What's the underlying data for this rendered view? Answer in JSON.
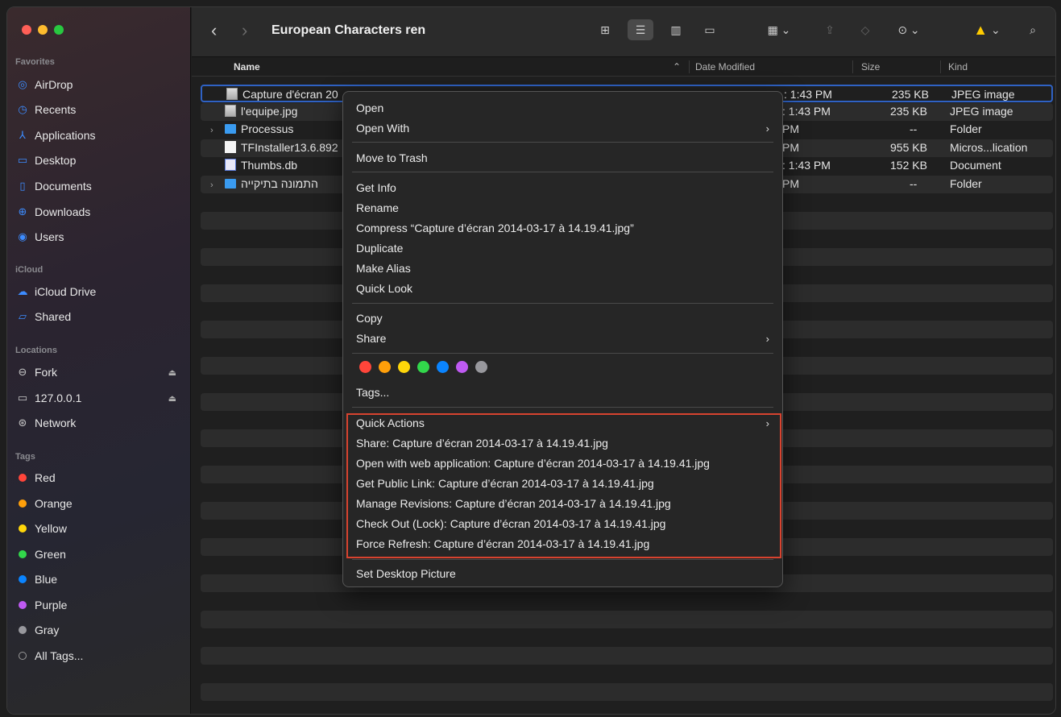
{
  "window": {
    "folder_title": "European Characters ren"
  },
  "sidebar": {
    "sections": {
      "favorites": "Favorites",
      "icloud": "iCloud",
      "locations": "Locations",
      "tags": "Tags"
    },
    "favorites": [
      {
        "label": "AirDrop",
        "icon": "airdrop-icon"
      },
      {
        "label": "Recents",
        "icon": "clock-icon"
      },
      {
        "label": "Applications",
        "icon": "applications-icon"
      },
      {
        "label": "Desktop",
        "icon": "desktop-icon"
      },
      {
        "label": "Documents",
        "icon": "document-icon"
      },
      {
        "label": "Downloads",
        "icon": "download-icon"
      },
      {
        "label": "Users",
        "icon": "user-icon"
      }
    ],
    "icloud": [
      {
        "label": "iCloud Drive",
        "icon": "cloud-icon"
      },
      {
        "label": "Shared",
        "icon": "shared-folder-icon"
      }
    ],
    "locations": [
      {
        "label": "Fork",
        "icon": "drive-icon"
      },
      {
        "label": "127.0.0.1",
        "icon": "monitor-icon"
      },
      {
        "label": "Network",
        "icon": "globe-icon"
      }
    ],
    "tags": [
      {
        "label": "Red",
        "color": "#ff453a"
      },
      {
        "label": "Orange",
        "color": "#ff9f0a"
      },
      {
        "label": "Yellow",
        "color": "#ffd60a"
      },
      {
        "label": "Green",
        "color": "#32d74b"
      },
      {
        "label": "Blue",
        "color": "#0a84ff"
      },
      {
        "label": "Purple",
        "color": "#bf5af2"
      },
      {
        "label": "Gray",
        "color": "#98989d"
      },
      {
        "label": "All Tags...",
        "color": ""
      }
    ]
  },
  "columns": {
    "name": "Name",
    "date_modified": "Date Modified",
    "size": "Size",
    "kind": "Kind"
  },
  "files": [
    {
      "name": "Capture d'écran 20",
      "date": ": 1:43 PM",
      "size": "235 KB",
      "kind": "JPEG image",
      "icon": "image-file-icon"
    },
    {
      "name": "l'equipe.jpg",
      "date": ": 1:43 PM",
      "size": "235 KB",
      "kind": "JPEG image",
      "icon": "image-file-icon"
    },
    {
      "name": "Processus",
      "date": "PM",
      "size": "--",
      "kind": "Folder",
      "icon": "folder-icon"
    },
    {
      "name": "TFInstaller13.6.892",
      "date": "PM",
      "size": "955 KB",
      "kind": "Micros...lication",
      "icon": "document-icon"
    },
    {
      "name": "Thumbs.db",
      "date": ": 1:43 PM",
      "size": "152 KB",
      "kind": "Document",
      "icon": "db-file-icon"
    },
    {
      "name": "התמונה בתיקייה",
      "date": "PM",
      "size": "--",
      "kind": "Folder",
      "icon": "folder-icon"
    }
  ],
  "context_menu": {
    "open": "Open",
    "open_with": "Open With",
    "move_to_trash": "Move to Trash",
    "get_info": "Get Info",
    "rename": "Rename",
    "compress": "Compress “Capture d’écran 2014-03-17 à 14.19.41.jpg”",
    "duplicate": "Duplicate",
    "make_alias": "Make Alias",
    "quick_look": "Quick Look",
    "copy": "Copy",
    "share": "Share",
    "tag_colors": [
      "#ff453a",
      "#ff9f0a",
      "#ffd60a",
      "#32d74b",
      "#0a84ff",
      "#bf5af2",
      "#98989d"
    ],
    "tags": "Tags...",
    "quick_actions": "Quick Actions",
    "qa_share": "Share: Capture d’écran 2014-03-17 à 14.19.41.jpg",
    "qa_open_web": "Open with web application: Capture d’écran 2014-03-17 à 14.19.41.jpg",
    "qa_public_link": "Get Public Link: Capture d’écran 2014-03-17 à 14.19.41.jpg",
    "qa_revisions": "Manage Revisions: Capture d’écran 2014-03-17 à 14.19.41.jpg",
    "qa_checkout": "Check Out (Lock): Capture d’écran 2014-03-17 à 14.19.41.jpg",
    "qa_refresh": "Force Refresh: Capture d’écran 2014-03-17 à 14.19.41.jpg",
    "set_desktop": "Set Desktop Picture"
  },
  "colors": {
    "accent": "#0a84ff",
    "highlight_border": "#d7432f",
    "selection_border": "#2f62c4"
  }
}
